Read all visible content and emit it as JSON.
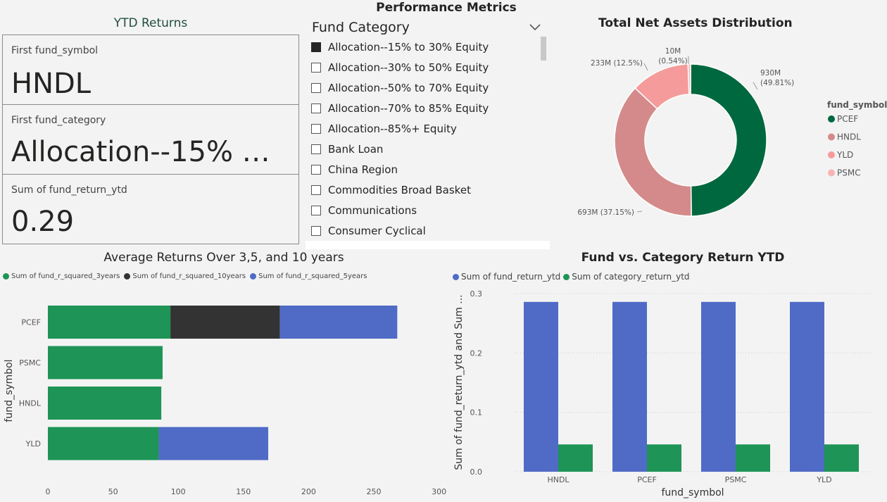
{
  "ytd": {
    "title": "YTD Returns",
    "cards": [
      {
        "label": "First fund_symbol",
        "value": "HNDL"
      },
      {
        "label": "First fund_category",
        "value": "Allocation--15% …"
      },
      {
        "label": "Sum of fund_return_ytd",
        "value": "0.29"
      }
    ]
  },
  "metrics": {
    "title": "Performance Metrics",
    "slicer_header": "Fund Category",
    "items": [
      {
        "label": "Allocation--15% to 30% Equity",
        "checked": true
      },
      {
        "label": "Allocation--30% to 50% Equity",
        "checked": false
      },
      {
        "label": "Allocation--50% to 70% Equity",
        "checked": false
      },
      {
        "label": "Allocation--70% to 85% Equity",
        "checked": false
      },
      {
        "label": "Allocation--85%+ Equity",
        "checked": false
      },
      {
        "label": "Bank Loan",
        "checked": false
      },
      {
        "label": "China Region",
        "checked": false
      },
      {
        "label": "Commodities Broad Basket",
        "checked": false
      },
      {
        "label": "Communications",
        "checked": false
      },
      {
        "label": "Consumer Cyclical",
        "checked": false
      }
    ]
  },
  "chart_data": [
    {
      "type": "pie",
      "title": "Total Net Assets Distribution",
      "legend_title": "fund_symbol",
      "legend_position": "right",
      "slices": [
        {
          "name": "PCEF",
          "label": "930M",
          "pct_label": "(49.81%)",
          "value": 930,
          "color": "#00683e"
        },
        {
          "name": "HNDL",
          "label": "693M (37.15%)",
          "pct_label": "",
          "value": 693,
          "color": "#d48a8a"
        },
        {
          "name": "YLD",
          "label": "233M (12.5%)",
          "pct_label": "",
          "value": 233,
          "color": "#f59b9b"
        },
        {
          "name": "PSMC",
          "label": "10M",
          "pct_label": "(0.54%)",
          "value": 10,
          "color": "#f8b4b4"
        }
      ]
    },
    {
      "type": "bar",
      "orientation": "horizontal",
      "stacked": true,
      "title": "Average Returns Over 3,5, and 10 years",
      "ylabel": "fund_symbol",
      "xlim": [
        0,
        300
      ],
      "xticks": [
        "0",
        "50",
        "100",
        "150",
        "200",
        "250",
        "300"
      ],
      "categories": [
        "PCEF",
        "PSMC",
        "HNDL",
        "YLD"
      ],
      "series": [
        {
          "name": "Sum of fund_r_squared_3years",
          "color": "#1e9457",
          "values": [
            94,
            88,
            87,
            85
          ]
        },
        {
          "name": "Sum of fund_r_squared_10years",
          "color": "#333333",
          "values": [
            84,
            0,
            0,
            0
          ]
        },
        {
          "name": "Sum of fund_r_squared_5years",
          "color": "#4f6bc6",
          "values": [
            90,
            0,
            0,
            84
          ]
        }
      ]
    },
    {
      "type": "bar",
      "orientation": "vertical",
      "title": "Fund vs. Category Return YTD",
      "xlabel": "fund_symbol",
      "ylabel": "Sum of fund_return_ytd and Sum ...",
      "ylim": [
        0,
        0.3
      ],
      "yticks": [
        "0.0",
        "0.1",
        "0.2",
        "0.3"
      ],
      "categories": [
        "HNDL",
        "PCEF",
        "PSMC",
        "YLD"
      ],
      "series": [
        {
          "name": "Sum of fund_return_ytd",
          "color": "#4f6bc6",
          "values": [
            0.286,
            0.286,
            0.286,
            0.286
          ]
        },
        {
          "name": "Sum of category_return_ytd",
          "color": "#1e9457",
          "values": [
            0.046,
            0.046,
            0.046,
            0.046
          ]
        }
      ]
    }
  ]
}
